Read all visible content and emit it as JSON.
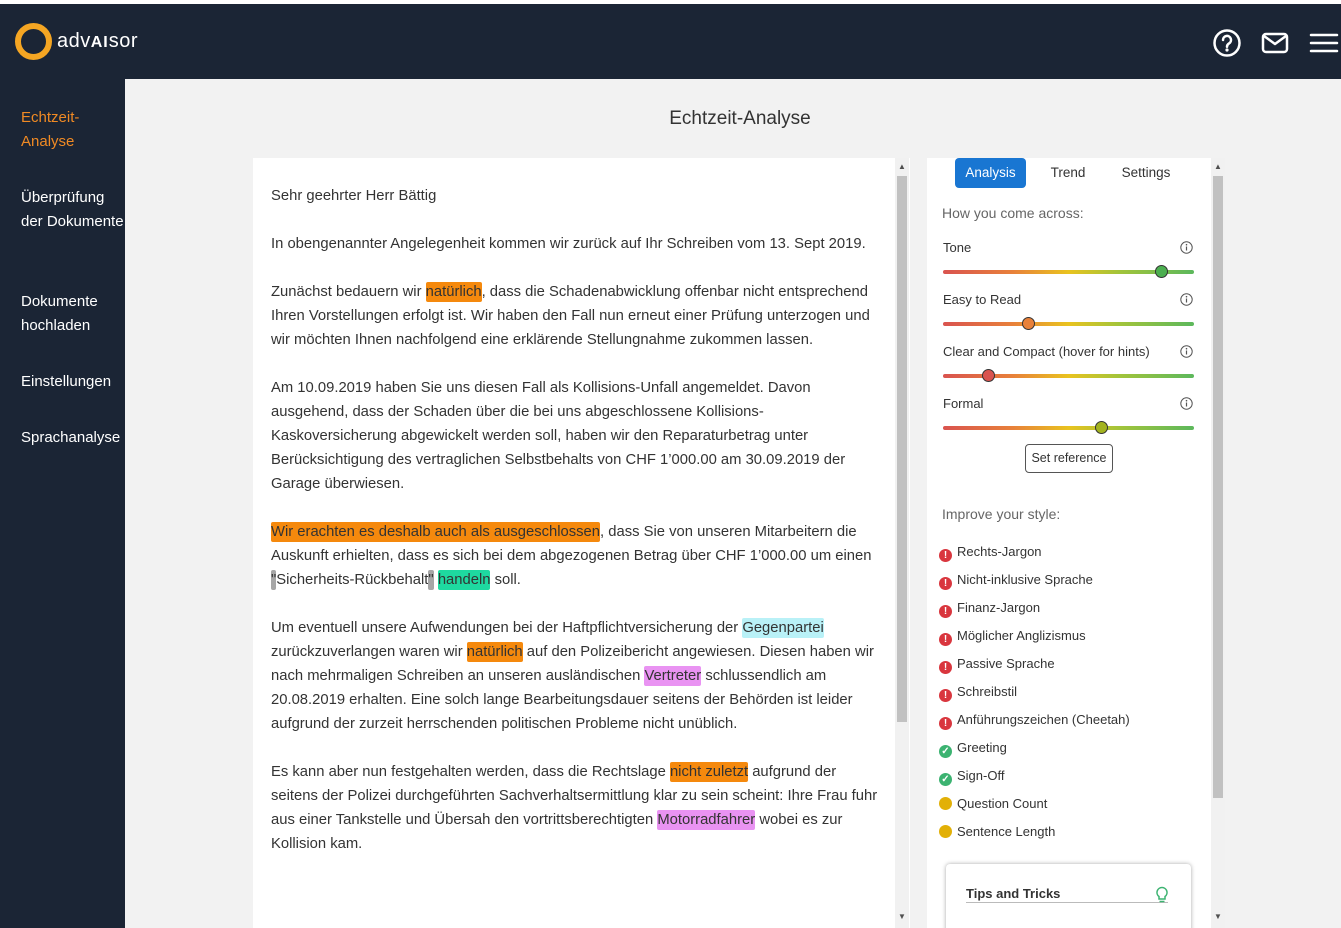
{
  "header": {
    "brand_light": "adv",
    "brand_bold": "AI",
    "brand_end": "sor",
    "icons": [
      "help-circle-icon",
      "mail-icon",
      "hamburger-menu-icon"
    ]
  },
  "sidebar": {
    "items": [
      {
        "label": "Echtzeit-Analyse",
        "active": true
      },
      {
        "label": "Überprüfung der Dokumente",
        "active": false
      },
      {
        "label": "Dokumente hochladen",
        "active": false
      },
      {
        "label": "Einstellungen",
        "active": false
      },
      {
        "label": "Sprachanalyse",
        "active": false
      }
    ]
  },
  "page": {
    "title": "Echtzeit-Analyse"
  },
  "colors": {
    "navy": "#1b2535",
    "accent": "#f08a24",
    "tab_active": "#1976d2",
    "hl_orange": "#f5890d",
    "hl_green": "#1ed9a0",
    "hl_cyan": "#b9f1f7",
    "hl_violet": "#e993f2",
    "hl_grey": "#a6a6a6"
  },
  "editor": {
    "p1": "Sehr geehrter Herr Bättig",
    "p2": "In obengenannter Angelegenheit kommen wir zurück auf Ihr Schreiben vom 13. Sept 2019.",
    "p3": {
      "a": "Zunächst bedauern wir ",
      "h1": "natürlich",
      "b": ", dass die Schadenabwicklung offenbar nicht entsprechend Ihren Vorstellungen erfolgt ist. Wir haben den Fall nun erneut einer Prüfung unterzogen und wir möchten Ihnen nachfolgend eine erklärende Stellungnahme zukommen lassen."
    },
    "p4": "Am 10.09.2019 haben Sie uns diesen Fall als Kollisions-Unfall angemeldet. Davon ausgehend, dass der Schaden über die bei uns abgeschlossene Kollisions-Kaskoversicherung abgewickelt werden soll, haben wir den Reparaturbetrag unter Berücksichtigung des vertraglichen Selbstbehalts von CHF 1’000.00 am 30.09.2019 der Garage überwiesen.",
    "p5": {
      "h1": "Wir erachten es deshalb auch als ausgeschlossen",
      "a": ", dass Sie von unseren Mitarbeitern die Auskunft erhielten, dass es sich bei dem abgezogenen Betrag über CHF 1’000.00 um einen ",
      "q1": "\"",
      "b": "Sicherheits-Rückbehalt",
      "q2": "\"",
      "c": " ",
      "h2": "handeln",
      "d": " soll."
    },
    "p6": {
      "a": "Um eventuell unsere Aufwendungen bei der Haftpflichtversicherung der ",
      "h1": "Gegenpartei",
      "b": " zurückzuverlangen waren wir ",
      "h2": "natürlich",
      "c": " auf den Polizeibericht angewiesen. Diesen haben wir nach mehrmaligen Schreiben an unseren ausländischen ",
      "h3": "Vertreter",
      "d": " schlussendlich am 20.08.2019 erhalten. Eine solch lange Bearbeitungsdauer seitens der Behörden ist leider aufgrund der zurzeit herrschenden politischen Probleme nicht unüblich."
    },
    "p7": {
      "a": "Es kann aber nun festgehalten werden, dass die Rechtslage ",
      "h1": "nicht zuletzt",
      "b": " aufgrund der seitens der Polizei durchgeführten Sachverhaltsermittlung klar zu sein scheint: Ihre Frau fuhr aus einer Tankstelle und Übersah den vortrittsberechtigten ",
      "h2": "Motorradfahrer",
      "c": " wobei es zur Kollision kam."
    }
  },
  "panel": {
    "tabs": [
      {
        "label": "Analysis",
        "active": true
      },
      {
        "label": "Trend",
        "active": false
      },
      {
        "label": "Settings",
        "active": false
      }
    ],
    "how_title": "How you come across:",
    "metrics": [
      {
        "label": "Tone",
        "value": 0.87,
        "color": "#4caf50"
      },
      {
        "label": "Easy to Read",
        "value": 0.34,
        "color": "#e8813a"
      },
      {
        "label": "Clear and Compact (hover for hints)",
        "value": 0.18,
        "color": "#d9534f"
      },
      {
        "label": "Formal",
        "value": 0.63,
        "color": "#a3b320"
      }
    ],
    "set_reference": "Set reference",
    "improve_title": "Improve your style:",
    "style_items": [
      {
        "label": "Rechts-Jargon",
        "status": "error"
      },
      {
        "label": "Nicht-inklusive Sprache",
        "status": "error"
      },
      {
        "label": "Finanz-Jargon",
        "status": "error"
      },
      {
        "label": "Möglicher Anglizismus",
        "status": "error"
      },
      {
        "label": "Passive Sprache",
        "status": "error"
      },
      {
        "label": "Schreibstil",
        "status": "error"
      },
      {
        "label": "Anführungszeichen (Cheetah)",
        "status": "error"
      },
      {
        "label": "Greeting",
        "status": "ok"
      },
      {
        "label": "Sign-Off",
        "status": "ok"
      },
      {
        "label": "Question Count",
        "status": "warn"
      },
      {
        "label": "Sentence Length",
        "status": "warn"
      }
    ],
    "status_colors": {
      "error": "#d9363e",
      "ok": "#3cb371",
      "warn": "#e2b007"
    },
    "tips_title": "Tips and Tricks"
  }
}
